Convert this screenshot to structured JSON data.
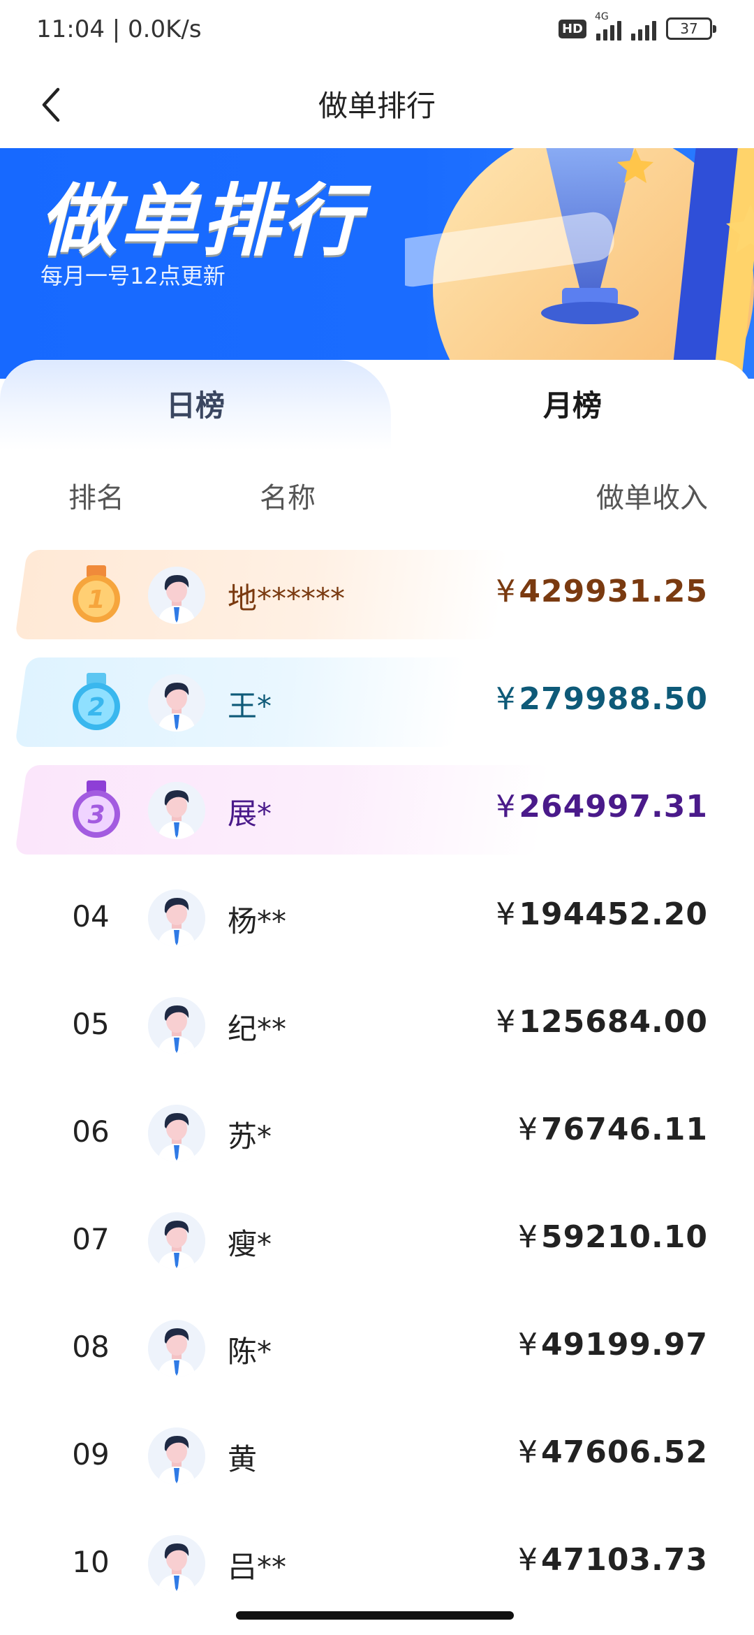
{
  "status_bar": {
    "time": "11:04 | 0.0K/s",
    "hd": "HD",
    "network": "4G",
    "battery": "37"
  },
  "nav": {
    "title": "做单排行"
  },
  "banner": {
    "title": "做单排行",
    "subtitle": "每月一号12点更新"
  },
  "tabs": [
    {
      "label": "日榜",
      "active": false
    },
    {
      "label": "月榜",
      "active": true
    }
  ],
  "columns": {
    "rank": "排名",
    "name": "名称",
    "income": "做单收入"
  },
  "currency_symbol": "¥",
  "rows": [
    {
      "rank": "1",
      "name": "地******",
      "income": "429931.25",
      "color": "#7a3a10",
      "bg": "#ffe9d6"
    },
    {
      "rank": "2",
      "name": "王*",
      "income": "279988.50",
      "color": "#0e5a78",
      "bg": "#dff3ff"
    },
    {
      "rank": "3",
      "name": "展*",
      "income": "264997.31",
      "color": "#4a1a8a",
      "bg": "#fbe6fb"
    },
    {
      "rank": "04",
      "name": "杨**",
      "income": "194452.20",
      "color": "#222222"
    },
    {
      "rank": "05",
      "name": "纪**",
      "income": "125684.00",
      "color": "#222222"
    },
    {
      "rank": "06",
      "name": "苏*",
      "income": "76746.11",
      "color": "#222222"
    },
    {
      "rank": "07",
      "name": "瘦*",
      "income": "59210.10",
      "color": "#222222"
    },
    {
      "rank": "08",
      "name": "陈*",
      "income": "49199.97",
      "color": "#222222"
    },
    {
      "rank": "09",
      "name": "黄",
      "income": "47606.52",
      "color": "#222222"
    },
    {
      "rank": "10",
      "name": "吕**",
      "income": "47103.73",
      "color": "#222222"
    }
  ],
  "colors": {
    "banner_blue": "#1769ff",
    "gold": "#f4a43a",
    "silver_blue": "#38b6ee",
    "purple": "#a35be0"
  }
}
